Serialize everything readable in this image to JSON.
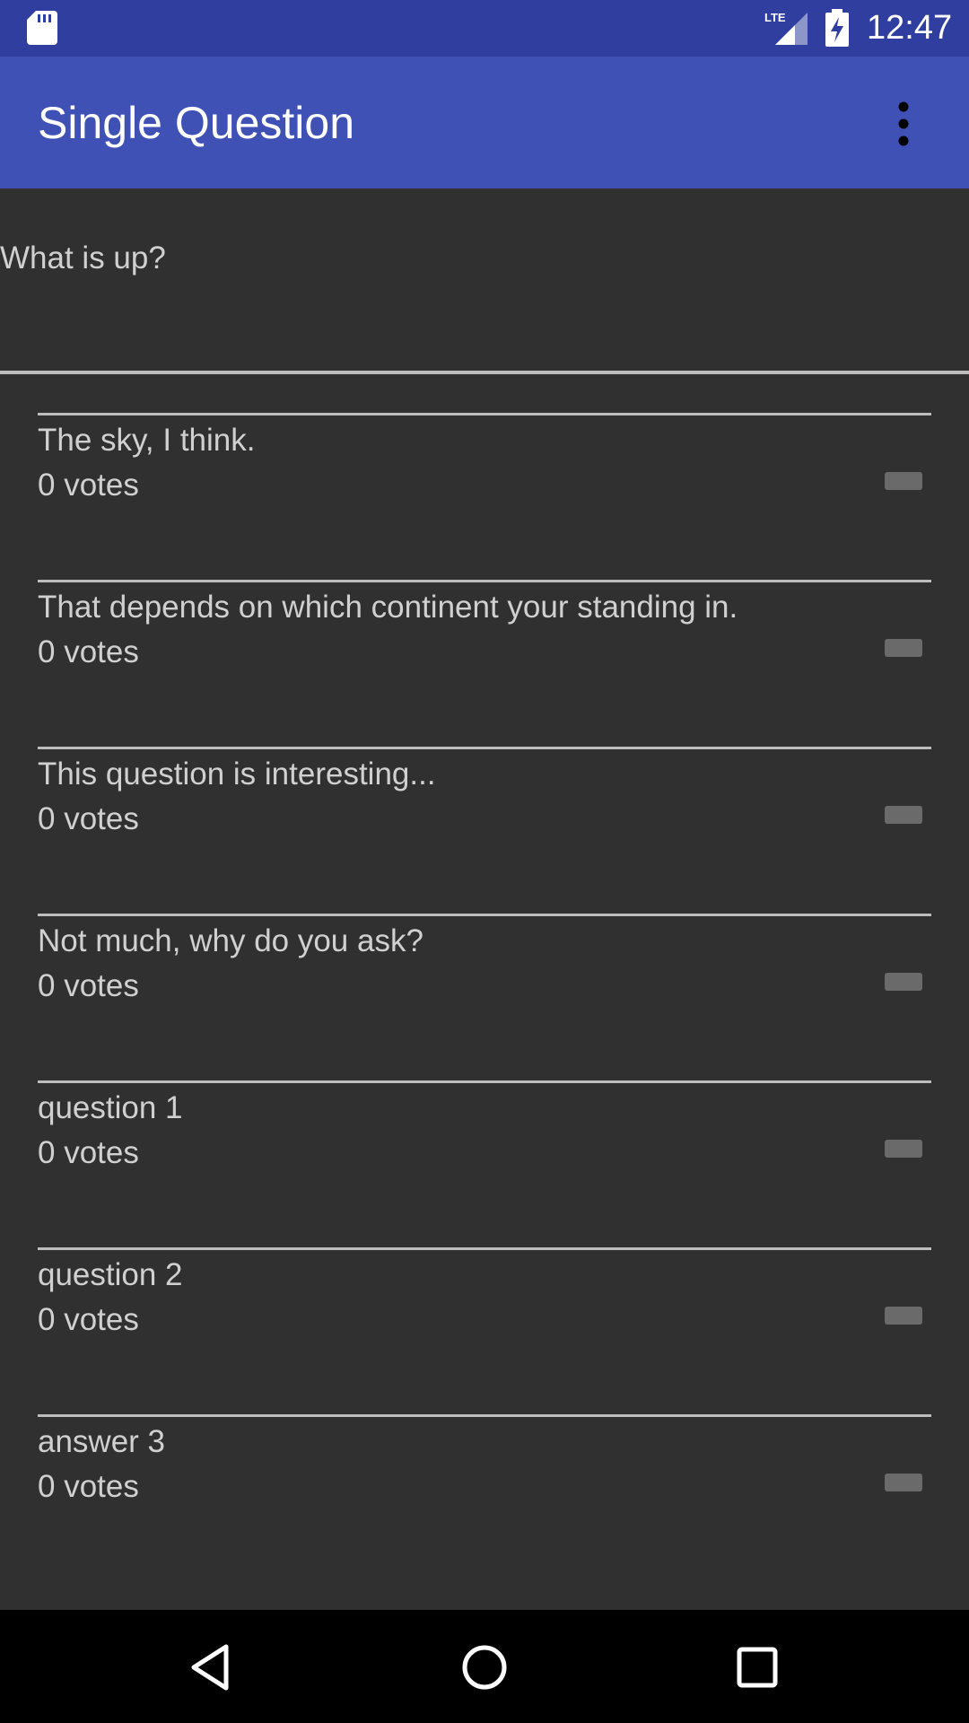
{
  "status_bar": {
    "time": "12:47",
    "network": "LTE",
    "icons": [
      "sd-card-icon",
      "lte-signal-icon",
      "battery-charging-icon"
    ]
  },
  "app_bar": {
    "title": "Single Question",
    "menu_icon": "more-vert-icon"
  },
  "question": {
    "text": "What is up?"
  },
  "answers": [
    {
      "text": "The sky, I think.",
      "votes": "0 votes"
    },
    {
      "text": "That depends on which continent your standing in.",
      "votes": "0 votes"
    },
    {
      "text": "This question is interesting...",
      "votes": "0 votes"
    },
    {
      "text": "Not much, why do you ask?",
      "votes": "0 votes"
    },
    {
      "text": "question 1",
      "votes": "0 votes"
    },
    {
      "text": "question 2",
      "votes": "0 votes"
    },
    {
      "text": "answer 3",
      "votes": "0 votes"
    }
  ],
  "nav_bar": {
    "icons": [
      "back-icon",
      "home-icon",
      "recents-icon"
    ]
  },
  "colors": {
    "status_bar": "#303F9F",
    "app_bar": "#3F51B5",
    "background": "#303030",
    "text": "#d0d0d0",
    "divider": "#bdbdbd"
  }
}
